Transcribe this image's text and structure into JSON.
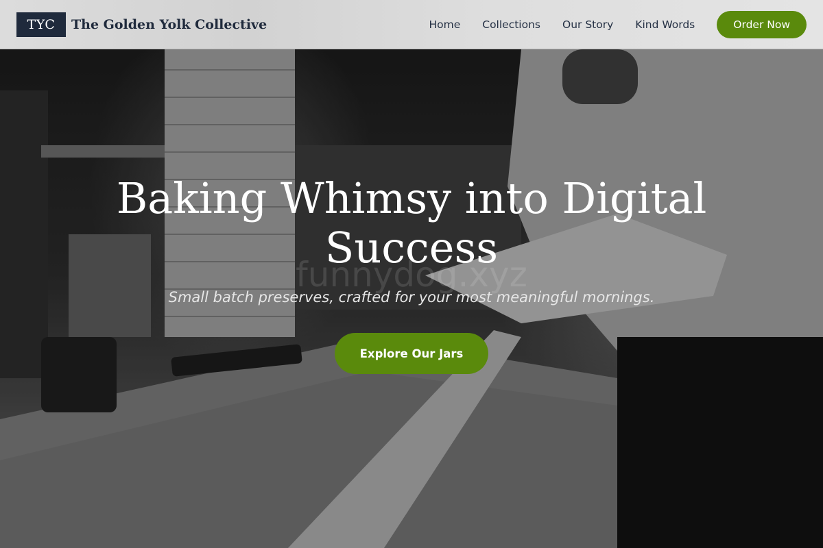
{
  "header": {
    "logo_text": "TYC",
    "brand_name": "The Golden Yolk Collective",
    "nav": [
      {
        "label": "Home"
      },
      {
        "label": "Collections"
      },
      {
        "label": "Our Story"
      },
      {
        "label": "Kind Words"
      }
    ],
    "order_button": "Order Now"
  },
  "hero": {
    "title": "Baking Whimsy into Digital Success",
    "watermark": "funnydog.xyz",
    "subtitle": "Small batch preserves, crafted for your most meaningful mornings.",
    "cta_button": "Explore Our Jars",
    "background": "black-and-white photo of a craftsman planing a wooden board at a workshop bench"
  },
  "colors": {
    "accent_green": "#5a8a0c",
    "navy": "#1f2a3c",
    "header_bg": "#dcdcdc"
  }
}
